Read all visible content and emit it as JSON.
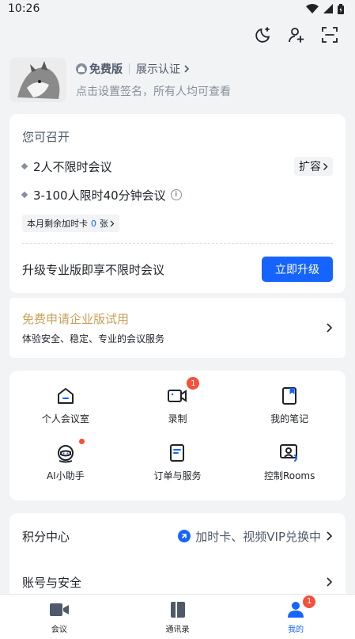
{
  "status_bar": {
    "time": "10:26"
  },
  "profile": {
    "plan": "免费版",
    "certify": "展示认证",
    "signature": "点击设置签名，所有人均可查看"
  },
  "meeting_card": {
    "title": "您可召开",
    "item1": "2人不限时会议",
    "expand": "扩容",
    "item2": "3-100人限时40分钟会议",
    "remain_prefix": "本月剩余加时卡",
    "remain_count": "0",
    "remain_suffix": "张",
    "upgrade_text": "升级专业版即享不限时会议",
    "upgrade_button": "立即升级"
  },
  "trial": {
    "title": "免费申请企业版试用",
    "subtitle": "体验安全、稳定、专业的会议服务"
  },
  "grid": {
    "personal_room": "个人会议室",
    "record": "录制",
    "record_badge": "1",
    "notes": "我的笔记",
    "ai_assistant": "AI小助手",
    "orders": "订单与服务",
    "rooms": "控制Rooms"
  },
  "list": {
    "points": "积分中心",
    "points_promo": "加时卡、视频VIP兑换中",
    "account": "账号与安全"
  },
  "tabs": {
    "meeting": "会议",
    "contacts": "通讯录",
    "mine": "我的",
    "mine_badge": "1"
  },
  "colors": {
    "accent": "#1664ff",
    "gold": "#c9a15a",
    "badge": "#f5503c"
  }
}
